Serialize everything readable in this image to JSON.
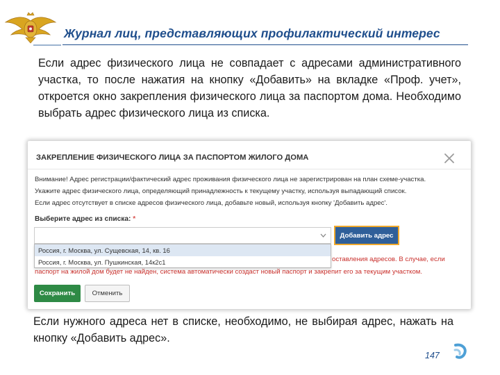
{
  "slide": {
    "title": "Журнал лиц, представляющих профилактический интерес",
    "intro": "Если адрес физического лица не совпадает с адресами административного участка, то после нажатия на кнопку «Добавить» на вкладке «Проф. учет», откроется окно закрепления физического лица за паспортом дома. Необходимо выбрать адрес физического лица из списка.",
    "outro": "Если нужного адреса нет в списке, необходимо, не выбирая адрес, нажать на кнопку «Добавить адрес».",
    "page_number": "147"
  },
  "dialog": {
    "title": "ЗАКРЕПЛЕНИЕ ФИЗИЧЕСКОГО ЛИЦА ЗА ПАСПОРТОМ ЖИЛОГО ДОМА",
    "warnings": [
      "Внимание! Адрес регистрации/фактический адрес проживания физического лица не зарегистрирован на план схеме-участка.",
      "Укажите адрес физического лица, определяющий принадлежность к текущему участку, используя выпадающий список.",
      "Если адрес отсутствует в списке адресов физического лица, добавьте новый, используя кнопку 'Добавить адрес'."
    ],
    "field_label": "Выберите адрес из списка:",
    "required_mark": "*",
    "select_value": "",
    "add_address_label": "Добавить адрес",
    "options": [
      "Россия, г. Москва, ул. Сущевская, 14, кв. 16",
      "Россия, г. Москва, ул. Пушкинская, 14к2с1"
    ],
    "info_lines": [
      "оставления адресов. В случае, если",
      "паспорт на жилой дом будет не найден, система автоматически создаст новый паспорт и закрепит его за текущим участком."
    ],
    "save_label": "Сохранить",
    "cancel_label": "Отменить"
  },
  "colors": {
    "title_blue": "#1f4e8c",
    "primary_button": "#2f5f99",
    "highlight_border": "#f0a92c",
    "save_green": "#2e8a45",
    "info_red": "#c9302c"
  },
  "icons": [
    "emblem-icon",
    "close-icon",
    "chevron-down-icon",
    "page-swirl-icon"
  ]
}
